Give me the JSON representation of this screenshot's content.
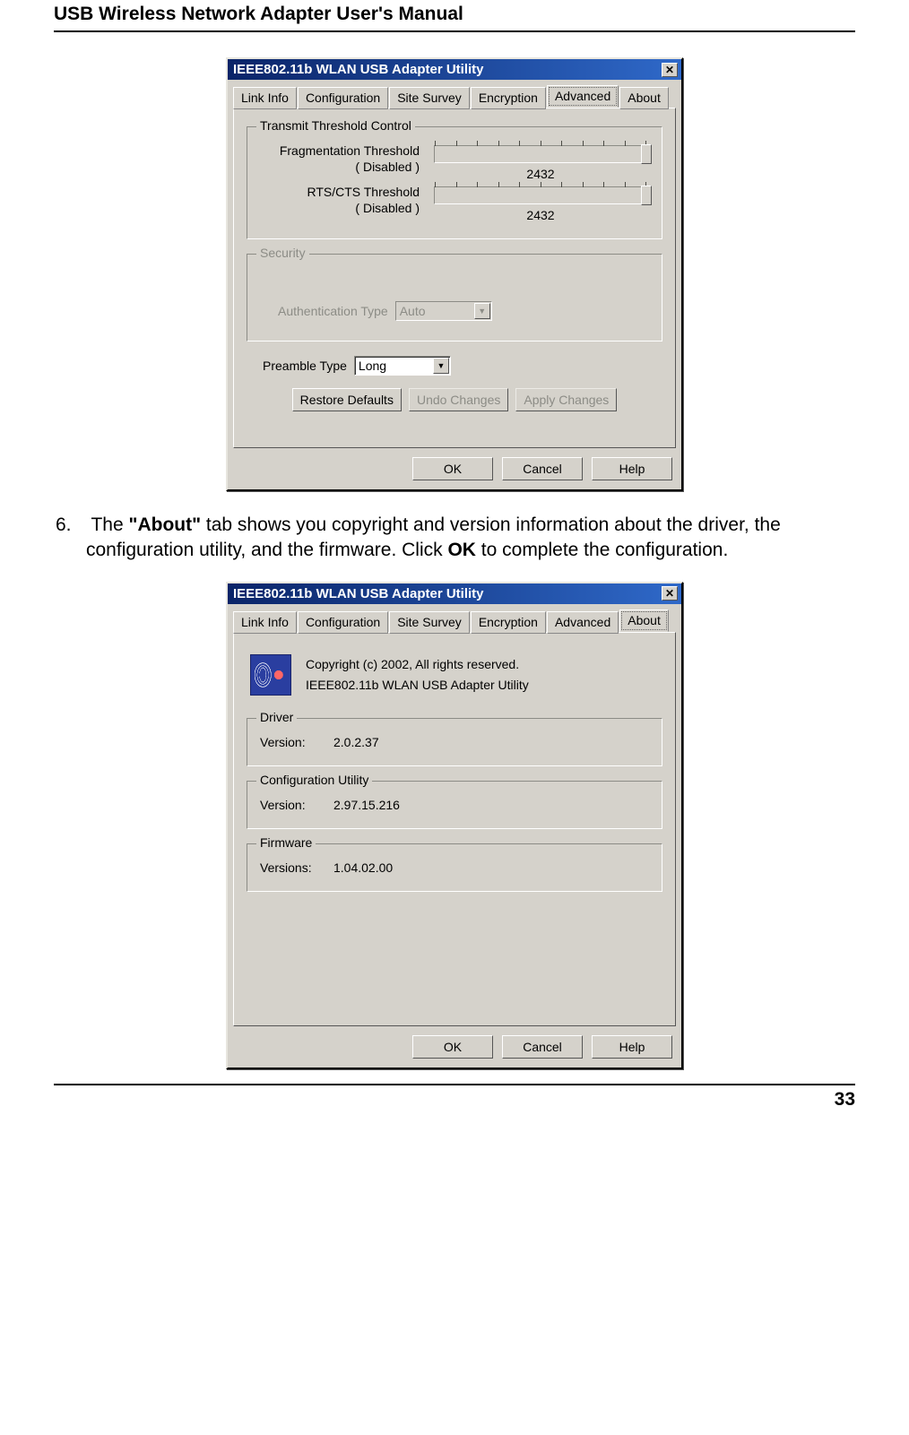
{
  "doc": {
    "header_title": "USB Wireless Network Adapter User's Manual",
    "page_number": "33"
  },
  "instruction": {
    "number": "6.",
    "text_pre": "The ",
    "bold1": "\"About\"",
    "text_mid": " tab shows you copyright and version information about the driver, the configuration utility, and the firmware. Click ",
    "bold2": "OK",
    "text_post": " to complete the configuration."
  },
  "dialog_common": {
    "title": "IEEE802.11b WLAN USB Adapter Utility",
    "close_glyph": "✕",
    "tabs": {
      "link_info": "Link Info",
      "configuration": "Configuration",
      "site_survey": "Site Survey",
      "encryption": "Encryption",
      "advanced": "Advanced",
      "about": "About"
    },
    "buttons": {
      "ok": "OK",
      "cancel": "Cancel",
      "help": "Help"
    }
  },
  "advanced_tab": {
    "groups": {
      "transmit_title": "Transmit Threshold Control",
      "security_title": "Security"
    },
    "frag": {
      "label_line1": "Fragmentation Threshold",
      "label_line2": "( Disabled )",
      "value": "2432"
    },
    "rts": {
      "label_line1": "RTS/CTS Threshold",
      "label_line2": "( Disabled )",
      "value": "2432"
    },
    "auth": {
      "label": "Authentication Type",
      "value": "Auto"
    },
    "preamble": {
      "label": "Preamble Type",
      "value": "Long"
    },
    "buttons": {
      "restore": "Restore Defaults",
      "undo": "Undo Changes",
      "apply": "Apply Changes"
    }
  },
  "about_tab": {
    "copyright": "Copyright (c) 2002, All rights reserved.",
    "product": "IEEE802.11b WLAN USB Adapter Utility",
    "driver": {
      "title": "Driver",
      "version_label": "Version:",
      "version": "2.0.2.37"
    },
    "config_util": {
      "title": "Configuration Utility",
      "version_label": "Version:",
      "version": "2.97.15.216"
    },
    "firmware": {
      "title": "Firmware",
      "version_label": "Versions:",
      "version": "1.04.02.00"
    }
  }
}
